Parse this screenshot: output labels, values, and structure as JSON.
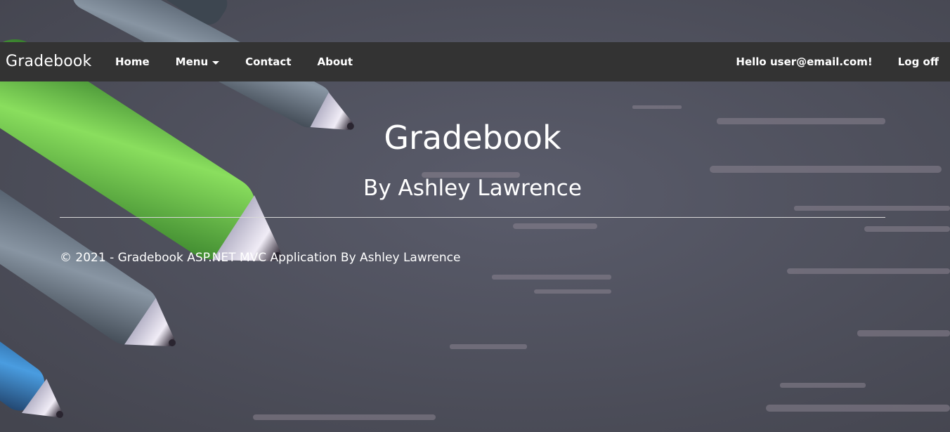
{
  "navbar": {
    "brand": "Gradebook",
    "items": [
      {
        "label": "Home"
      },
      {
        "label": "Menu"
      },
      {
        "label": "Contact"
      },
      {
        "label": "About"
      }
    ],
    "greeting": "Hello user@email.com!",
    "logoff": "Log off"
  },
  "main": {
    "title": "Gradebook",
    "subtitle": "By Ashley Lawrence"
  },
  "footer": {
    "text": "© 2021 - Gradebook ASP.NET MVC Application By Ashley Lawrence"
  },
  "colors": {
    "navbar_bg": "#333333",
    "text": "#ffffff",
    "background": "#4f5260",
    "pen_green": "#7fe05a",
    "pen_blue": "#2f8fd8"
  },
  "icons": {
    "menu_dropdown": "caret-down-icon"
  }
}
